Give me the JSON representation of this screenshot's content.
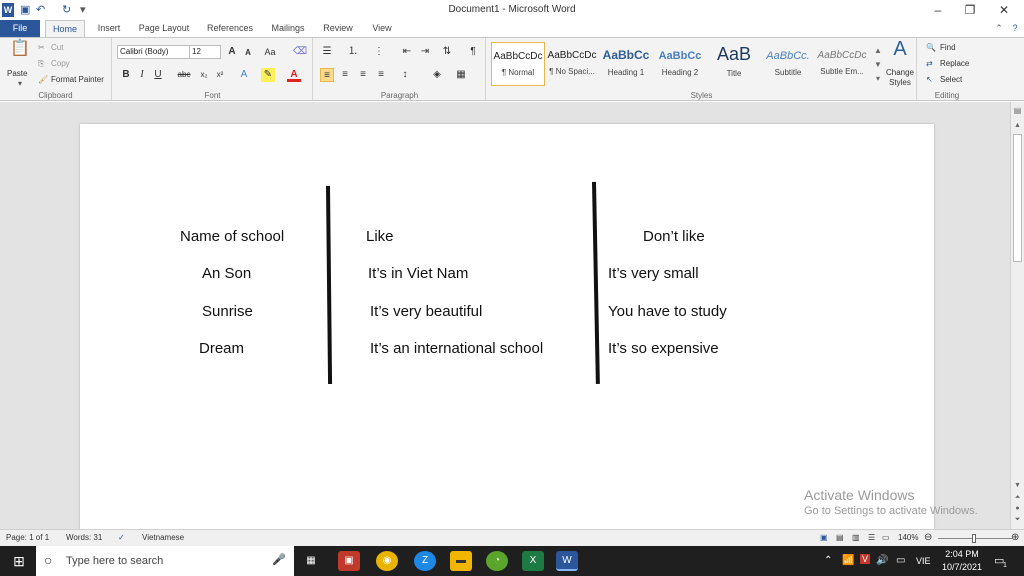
{
  "window": {
    "title": "Document1 - Microsoft Word",
    "minimize": "–",
    "restore": "❐",
    "close": "✕"
  },
  "tabs": {
    "file": "File",
    "home": "Home",
    "insert": "Insert",
    "page_layout": "Page Layout",
    "references": "References",
    "mailings": "Mailings",
    "review": "Review",
    "view": "View"
  },
  "ribbon": {
    "clipboard": {
      "label": "Clipboard",
      "paste": "Paste",
      "cut": "Cut",
      "copy": "Copy",
      "format_painter": "Format Painter"
    },
    "font": {
      "label": "Font",
      "family": "Calibri (Body)",
      "size": "12"
    },
    "paragraph": {
      "label": "Paragraph"
    },
    "styles": {
      "label": "Styles",
      "items": [
        {
          "preview": "AaBbCcDc",
          "name": "¶ Normal"
        },
        {
          "preview": "AaBbCcDc",
          "name": "¶ No Spaci..."
        },
        {
          "preview": "AaBbCc",
          "name": "Heading 1"
        },
        {
          "preview": "AaBbCc",
          "name": "Heading 2"
        },
        {
          "preview": "AaB",
          "name": "Title"
        },
        {
          "preview": "AaBbCc.",
          "name": "Subtitle"
        },
        {
          "preview": "AaBbCcDc",
          "name": "Subtle Em..."
        }
      ],
      "change_styles": "Change Styles"
    },
    "editing": {
      "label": "Editing",
      "find": "Find",
      "replace": "Replace",
      "select": "Select"
    }
  },
  "document": {
    "columns": {
      "col1": [
        "Name of school",
        "An Son",
        "Sunrise",
        "Dream"
      ],
      "col2": [
        "Like",
        "It’s in Viet Nam",
        "It’s very beautiful",
        "It’s an international school"
      ],
      "col3": [
        "Don’t like",
        "It’s very small",
        "You have to study",
        "It’s so expensive"
      ]
    }
  },
  "watermark": {
    "title": "Activate Windows",
    "subtitle": "Go to Settings to activate Windows."
  },
  "status": {
    "page": "Page: 1 of 1",
    "words": "Words: 31",
    "language": "Vietnamese",
    "zoom": "140%"
  },
  "taskbar": {
    "search_placeholder": "Type here to search",
    "time": "2:04 PM",
    "date": "10/7/2021",
    "lang": "VIE",
    "notification_count": "1"
  }
}
